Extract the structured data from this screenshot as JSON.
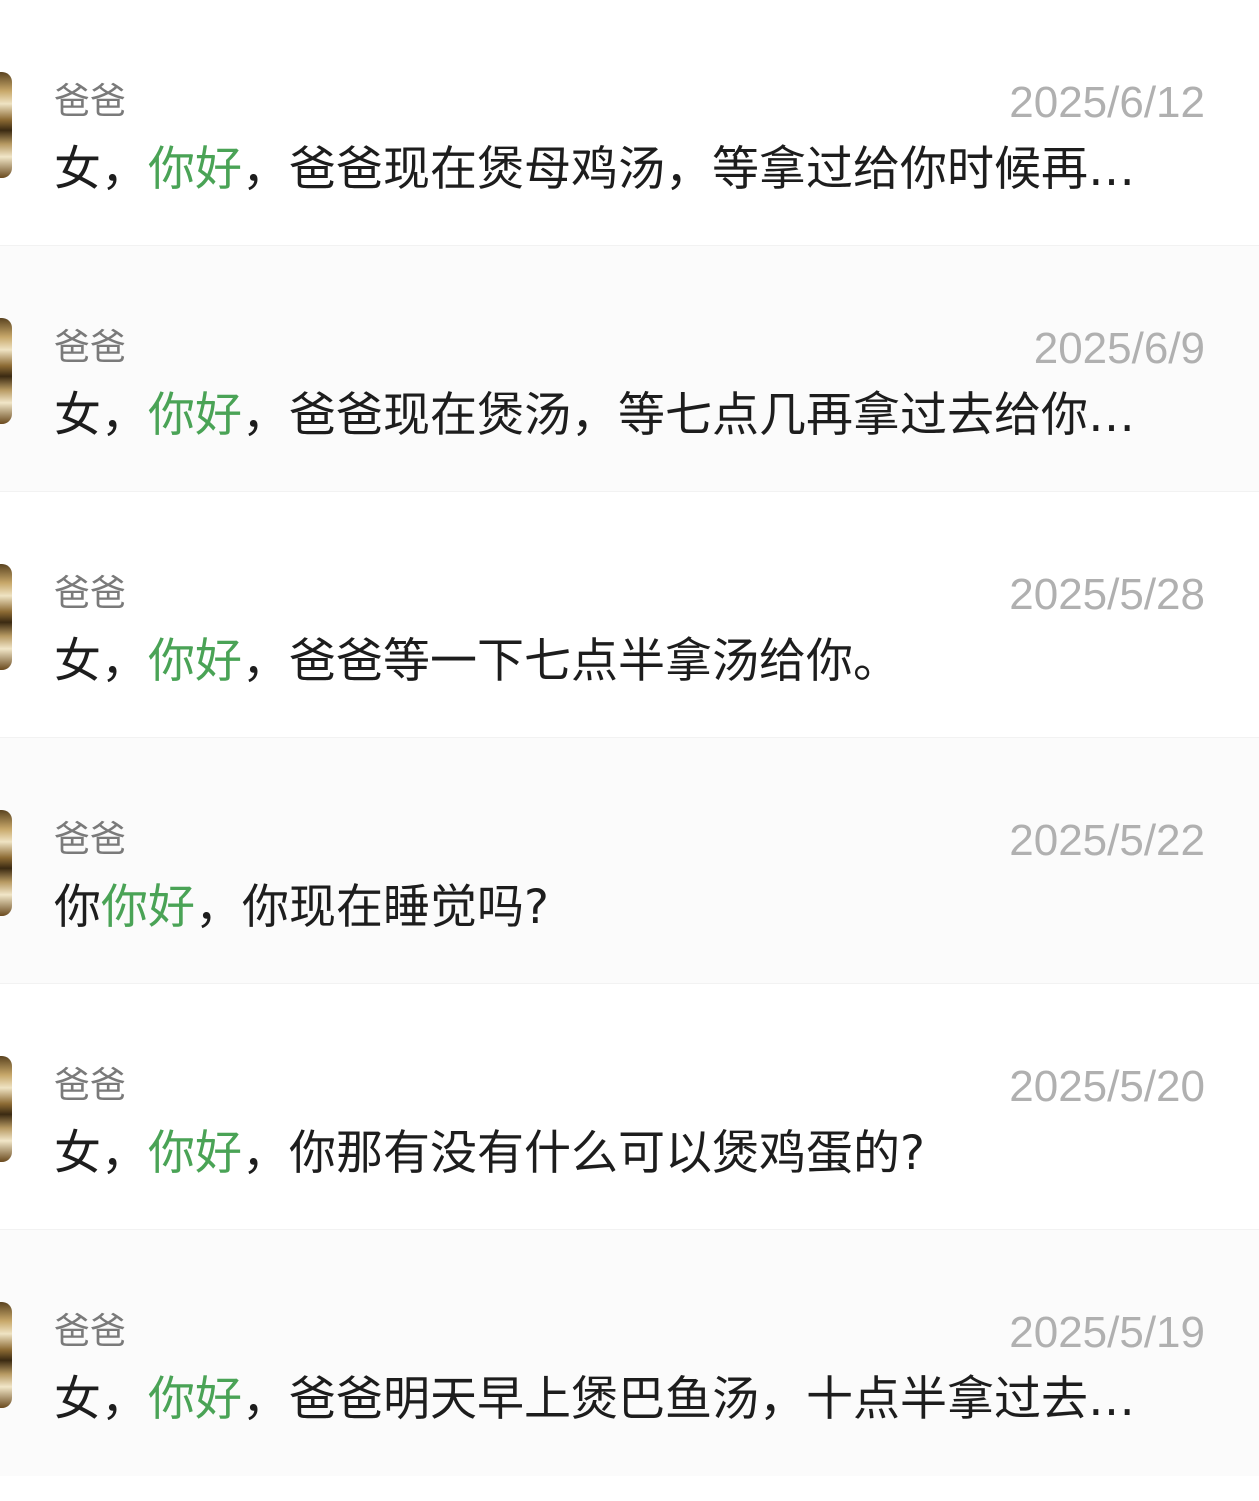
{
  "results": [
    {
      "sender": "爸爸",
      "date": "2025/6/12",
      "message_before": "女，",
      "message_highlight": "你好",
      "message_after": "，爸爸现在煲母鸡汤，等拿过给你时候再…"
    },
    {
      "sender": "爸爸",
      "date": "2025/6/9",
      "message_before": "女，",
      "message_highlight": "你好",
      "message_after": "，爸爸现在煲汤，等七点几再拿过去给你…"
    },
    {
      "sender": "爸爸",
      "date": "2025/5/28",
      "message_before": "女，",
      "message_highlight": "你好",
      "message_after": "，爸爸等一下七点半拿汤给你。"
    },
    {
      "sender": "爸爸",
      "date": "2025/5/22",
      "message_before": "你",
      "message_highlight": "你好",
      "message_after": "，你现在睡觉吗?"
    },
    {
      "sender": "爸爸",
      "date": "2025/5/20",
      "message_before": "女，",
      "message_highlight": "你好",
      "message_after": "，你那有没有什么可以煲鸡蛋的?"
    },
    {
      "sender": "爸爸",
      "date": "2025/5/19",
      "message_before": "女，",
      "message_highlight": "你好",
      "message_after": "，爸爸明天早上煲巴鱼汤，十点半拿过去…"
    }
  ],
  "colors": {
    "highlight": "#4aa356",
    "sender": "#7a7a7a",
    "date": "#b0b0b0",
    "message": "#1d1d1d"
  },
  "icons": {
    "avatar": "contact-avatar-photo"
  }
}
